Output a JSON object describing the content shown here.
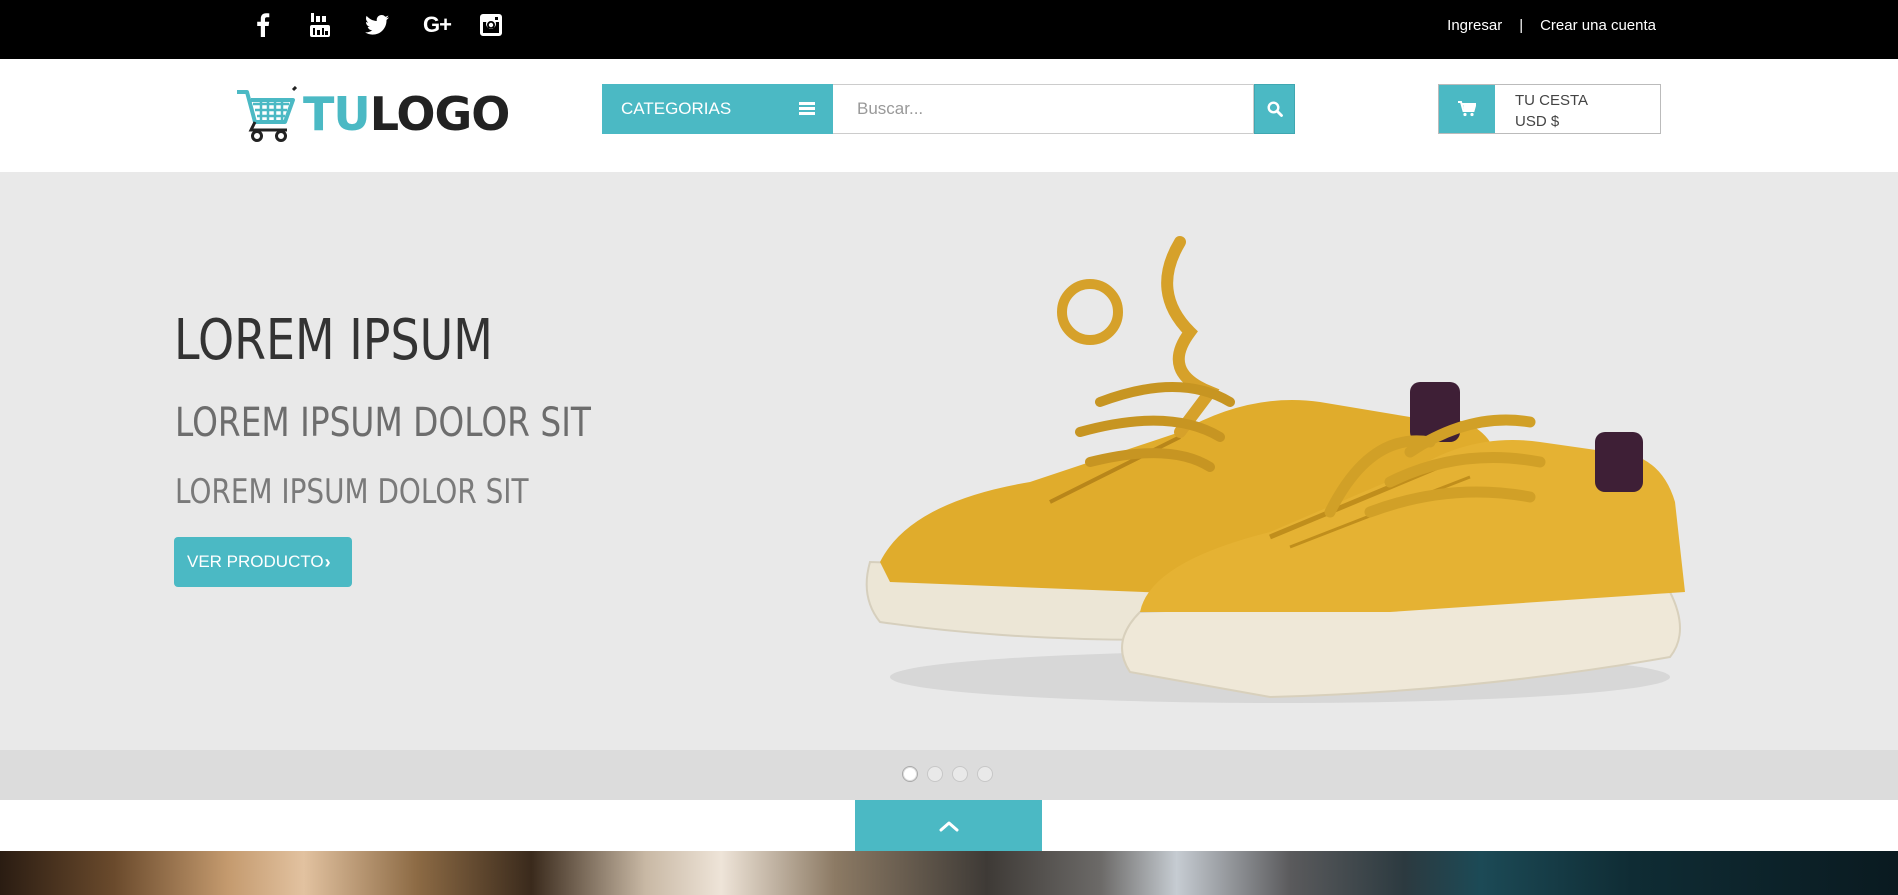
{
  "top_bar": {
    "social_icons": [
      "facebook-icon",
      "youtube-icon",
      "twitter-icon",
      "google-plus-icon",
      "instagram-icon"
    ],
    "google_plus_glyph": "G+",
    "login_label": "Ingresar",
    "separator": "|",
    "register_label": "Crear una cuenta"
  },
  "header": {
    "logo": {
      "part1": "TU",
      "part2": "LOGO"
    },
    "categories_label": "CATEGORIAS",
    "search_placeholder": "Buscar...",
    "cart": {
      "line1": "TU CESTA",
      "line2": "USD $"
    }
  },
  "hero": {
    "title": "LOREM IPSUM",
    "subtitle1": "LOREM IPSUM DOLOR SIT",
    "subtitle2": "LOREM IPSUM DOLOR SIT",
    "button_label": "VER PRODUCTO",
    "button_chevron": "›",
    "slides_count": 4,
    "active_slide": 1
  },
  "colors": {
    "accent": "#4bb9c4",
    "topbar": "#000000",
    "hero_bg": "#e9e9e9",
    "shoe": "#e0ac2c"
  }
}
